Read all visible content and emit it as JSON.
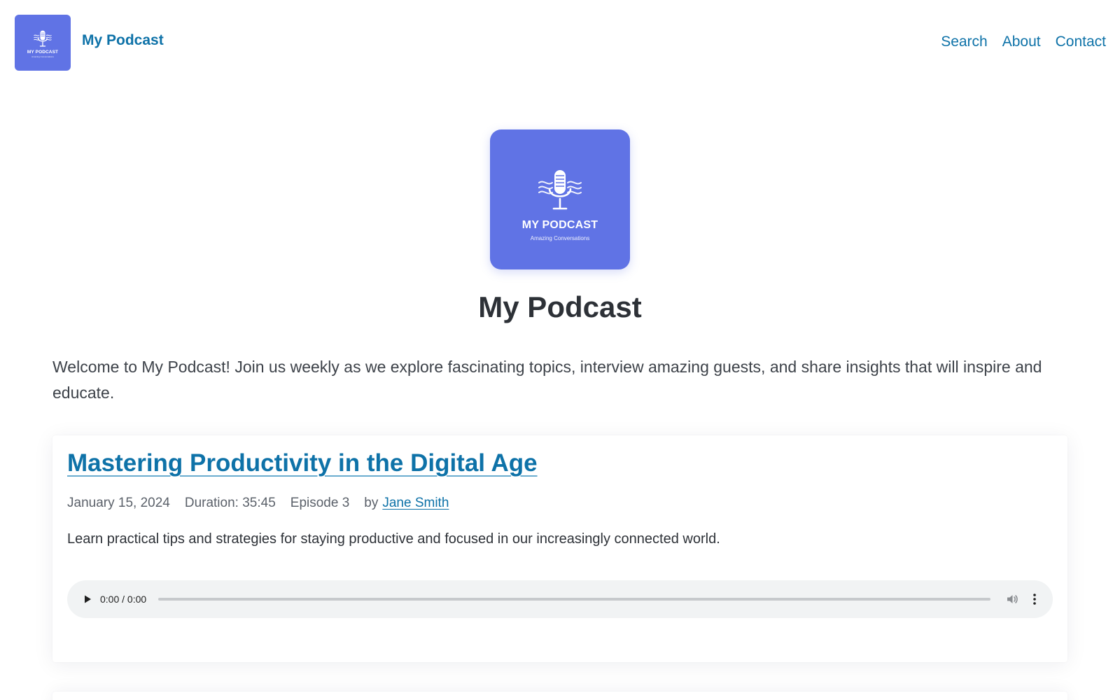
{
  "header": {
    "logo": {
      "icon": "microphone-icon",
      "title": "MY PODCAST",
      "tagline": "Amazing Conversations"
    },
    "site_title": "My Podcast",
    "nav": [
      {
        "label": "Search"
      },
      {
        "label": "About"
      },
      {
        "label": "Contact"
      }
    ]
  },
  "hero": {
    "cover": {
      "icon": "microphone-icon",
      "title": "MY PODCAST",
      "tagline": "Amazing Conversations"
    },
    "title": "My Podcast",
    "intro": "Welcome to My Podcast! Join us weekly as we explore fascinating topics, interview amazing guests, and share insights that will inspire and educate."
  },
  "episodes": [
    {
      "title": "Mastering Productivity in the Digital Age",
      "date": "January 15, 2024",
      "duration": "Duration: 35:45",
      "episode": "Episode 3",
      "by": "by",
      "author": "Jane Smith",
      "description": "Learn practical tips and strategies for staying productive and focused in our increasingly connected world.",
      "player": {
        "time": "0:00 / 0:00",
        "progress": 0
      }
    }
  ],
  "colors": {
    "brand": "#6073e5",
    "link": "#0e72a8",
    "text": "#2d3137",
    "meta": "#5b616a",
    "player_bg": "#f1f3f4"
  }
}
